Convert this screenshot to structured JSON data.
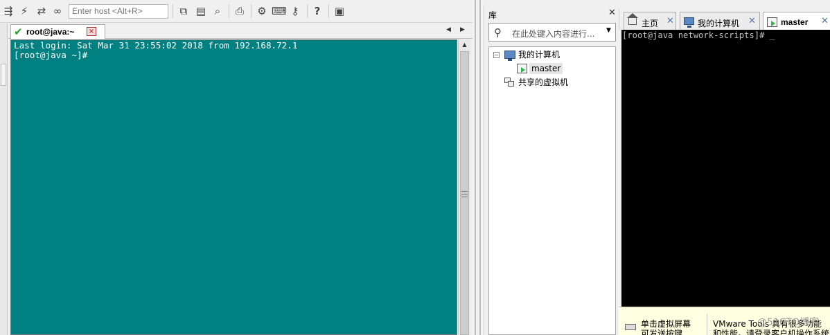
{
  "securecrt": {
    "toolbar": {
      "host_placeholder": "Enter host <Alt+R>",
      "icons": [
        "connect-bar-icon",
        "lightning-icon",
        "reconnect-icon",
        "link-icon",
        "copy-icon",
        "paste-icon",
        "find-icon",
        "print-icon",
        "settings-icon",
        "keymap-icon",
        "sftp-icon",
        "help-icon",
        "screen-icon"
      ]
    },
    "session_tab": {
      "label": "root@java:~",
      "status_color": "#1fa51f"
    },
    "terminal": {
      "background": "#008080",
      "lines": [
        "Last login: Sat Mar 31 23:55:02 2018 from 192.168.72.1",
        "[root@java ~]#"
      ]
    }
  },
  "vmware": {
    "library": {
      "title": "库",
      "search_placeholder": "在此处键入内容进行...",
      "tree": {
        "root": "我的计算机",
        "vm": "master",
        "shared": "共享的虚拟机"
      }
    },
    "tabs": [
      {
        "label": "主页"
      },
      {
        "label": "我的计算机"
      },
      {
        "label": "master"
      }
    ],
    "console": {
      "line": "[root@java network-scripts]# _"
    },
    "hint": {
      "left": "单击虚拟屏幕\n可发送按键",
      "right": "VMware Tools 具有很多功能\n和性能。请登录客户机操作系统"
    },
    "watermark": "@51CTO博客"
  }
}
